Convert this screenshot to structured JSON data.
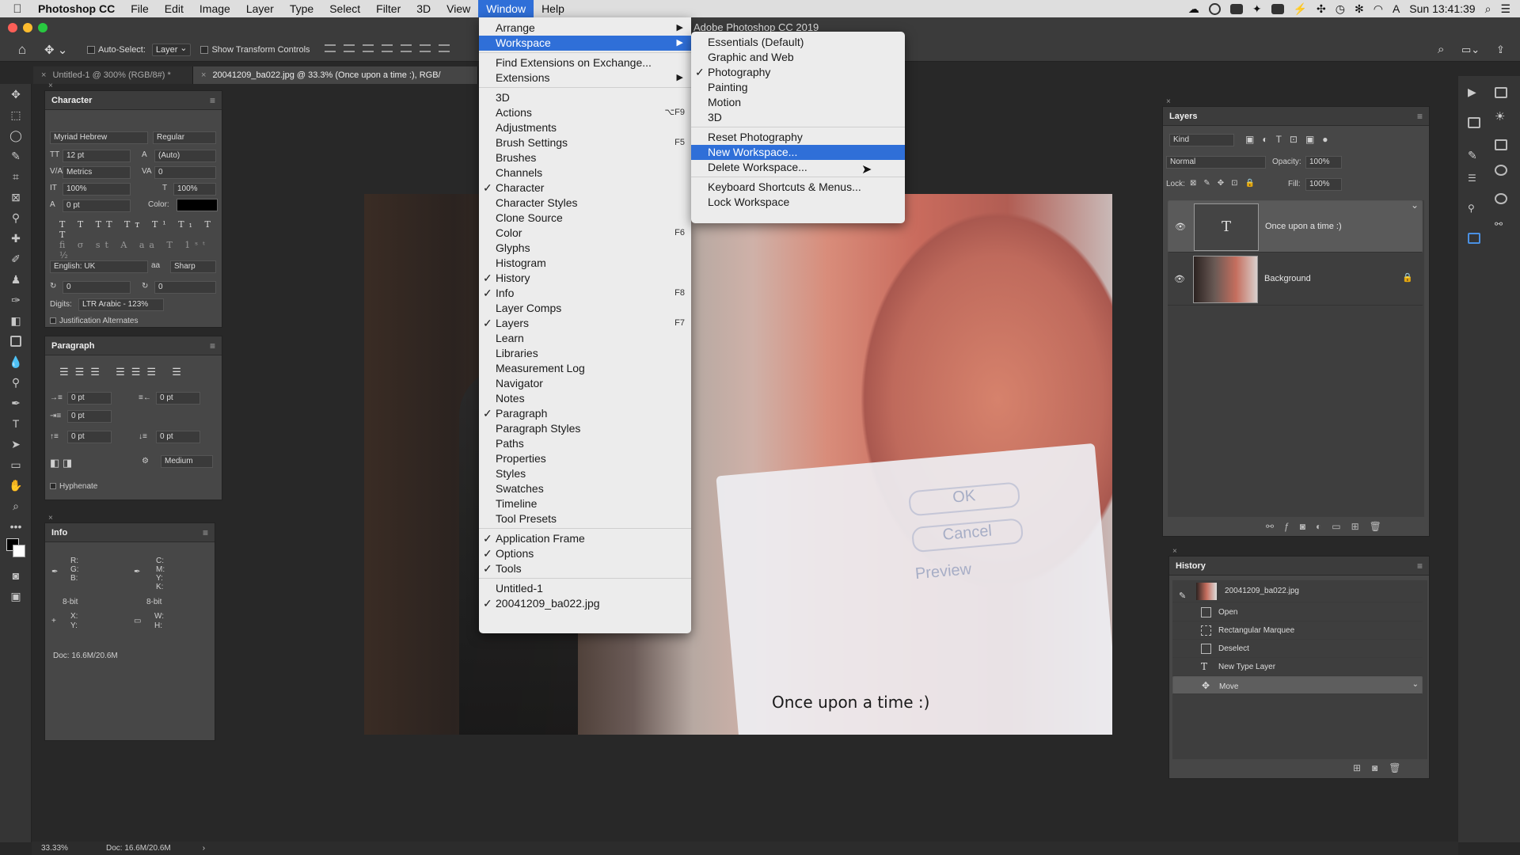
{
  "menubar": {
    "app_name": "Photoshop CC",
    "items": [
      "File",
      "Edit",
      "Image",
      "Layer",
      "Type",
      "Select",
      "Filter",
      "3D",
      "View",
      "Window",
      "Help"
    ],
    "active_item": "Window",
    "clock": "Sun 13:41:39"
  },
  "options_bar": {
    "auto_select_label": "Auto-Select:",
    "auto_select_value": "Layer",
    "transform_controls_label": "Show Transform Controls"
  },
  "tabs": [
    {
      "label": "Untitled-1 @ 300% (RGB/8#) *"
    },
    {
      "label": "20041209_ba022.jpg @ 33.3% (Once upon a time :), RGB/"
    }
  ],
  "window_menu": {
    "items": [
      {
        "label": "Arrange",
        "submenu": true
      },
      {
        "label": "Workspace",
        "submenu": true,
        "highlight": true
      },
      {
        "sep": true
      },
      {
        "label": "Find Extensions on Exchange..."
      },
      {
        "label": "Extensions",
        "submenu": true
      },
      {
        "sep": true
      },
      {
        "label": "3D"
      },
      {
        "label": "Actions",
        "shortcut": "⌥F9"
      },
      {
        "label": "Adjustments"
      },
      {
        "label": "Brush Settings",
        "shortcut": "F5"
      },
      {
        "label": "Brushes"
      },
      {
        "label": "Channels"
      },
      {
        "label": "Character",
        "checked": true
      },
      {
        "label": "Character Styles"
      },
      {
        "label": "Clone Source"
      },
      {
        "label": "Color",
        "shortcut": "F6"
      },
      {
        "label": "Glyphs"
      },
      {
        "label": "Histogram"
      },
      {
        "label": "History",
        "checked": true
      },
      {
        "label": "Info",
        "checked": true,
        "shortcut": "F8"
      },
      {
        "label": "Layer Comps"
      },
      {
        "label": "Layers",
        "checked": true,
        "shortcut": "F7"
      },
      {
        "label": "Learn"
      },
      {
        "label": "Libraries"
      },
      {
        "label": "Measurement Log"
      },
      {
        "label": "Navigator"
      },
      {
        "label": "Notes"
      },
      {
        "label": "Paragraph",
        "checked": true
      },
      {
        "label": "Paragraph Styles"
      },
      {
        "label": "Paths"
      },
      {
        "label": "Properties"
      },
      {
        "label": "Styles"
      },
      {
        "label": "Swatches"
      },
      {
        "label": "Timeline"
      },
      {
        "label": "Tool Presets"
      },
      {
        "sep": true
      },
      {
        "label": "Application Frame",
        "checked": true
      },
      {
        "label": "Options",
        "checked": true
      },
      {
        "label": "Tools",
        "checked": true
      },
      {
        "sep": true
      },
      {
        "label": "Untitled-1"
      },
      {
        "label": "20041209_ba022.jpg",
        "checked": true
      }
    ]
  },
  "workspace_menu": {
    "app_info": "Adobe Photoshop CC 2019",
    "items": [
      {
        "label": "Essentials (Default)"
      },
      {
        "label": "Graphic and Web"
      },
      {
        "label": "Photography",
        "checked": true
      },
      {
        "label": "Painting"
      },
      {
        "label": "Motion"
      },
      {
        "label": "3D"
      },
      {
        "sep": true
      },
      {
        "label": "Reset Photography"
      },
      {
        "label": "New Workspace...",
        "highlight": true
      },
      {
        "label": "Delete Workspace..."
      },
      {
        "sep": true
      },
      {
        "label": "Keyboard Shortcuts & Menus..."
      },
      {
        "label": "Lock Workspace"
      }
    ]
  },
  "character_panel": {
    "title": "Character",
    "font_family": "Myriad Hebrew",
    "font_style": "Regular",
    "size": "12 pt",
    "leading": "(Auto)",
    "kerning": "Metrics",
    "tracking": "0",
    "vscale": "100%",
    "hscale": "100%",
    "baseline": "0 pt",
    "color_label": "Color:",
    "language": "English: UK",
    "antialias": "Sharp",
    "rot1": "0",
    "rot2": "0",
    "digits_label": "Digits:",
    "digits_value": "LTR Arabic - 123%",
    "justification_alternates": "Justification Alternates"
  },
  "paragraph_panel": {
    "title": "Paragraph",
    "indent_left": "0 pt",
    "indent_right": "0 pt",
    "first_line": "0 pt",
    "space_before": "0 pt",
    "space_after": "0 pt",
    "compose": "Medium",
    "hyphenate": "Hyphenate"
  },
  "info_panel": {
    "title": "Info",
    "rgb_labels": "R:\nG:\nB:",
    "cmyk_labels": "C:\nM:\nY:\nK:",
    "bit_left": "8-bit",
    "bit_right": "8-bit",
    "xy_labels": "X:\nY:",
    "wh_labels": "W:\nH:",
    "doc": "Doc: 16.6M/20.6M"
  },
  "layers_panel": {
    "title": "Layers",
    "kind": "Kind",
    "blend_mode": "Normal",
    "opacity_label": "Opacity:",
    "opacity": "100%",
    "lock_label": "Lock:",
    "fill_label": "Fill:",
    "fill": "100%",
    "layers": [
      {
        "name": "Once upon a time :)",
        "type": "text",
        "selected": true
      },
      {
        "name": "Background",
        "type": "image",
        "locked": true
      }
    ]
  },
  "history_panel": {
    "title": "History",
    "snapshot": "20041209_ba022.jpg",
    "steps": [
      {
        "label": "Open",
        "icon": "document-icon"
      },
      {
        "label": "Rectangular Marquee",
        "icon": "marquee-icon"
      },
      {
        "label": "Deselect",
        "icon": "document-icon"
      },
      {
        "label": "New Type Layer",
        "icon": "type-icon"
      },
      {
        "label": "Move",
        "icon": "move-icon",
        "selected": true
      }
    ]
  },
  "canvas": {
    "caption": "Once upon a time :)",
    "dialog_ok": "OK",
    "dialog_cancel": "Cancel",
    "dialog_preview": "Preview"
  },
  "status": {
    "zoom": "33.33%",
    "doc": "Doc: 16.6M/20.6M"
  },
  "colors": {
    "highlight": "#2f6fd8",
    "panel_bg": "#474747",
    "app_bg": "#282828"
  }
}
